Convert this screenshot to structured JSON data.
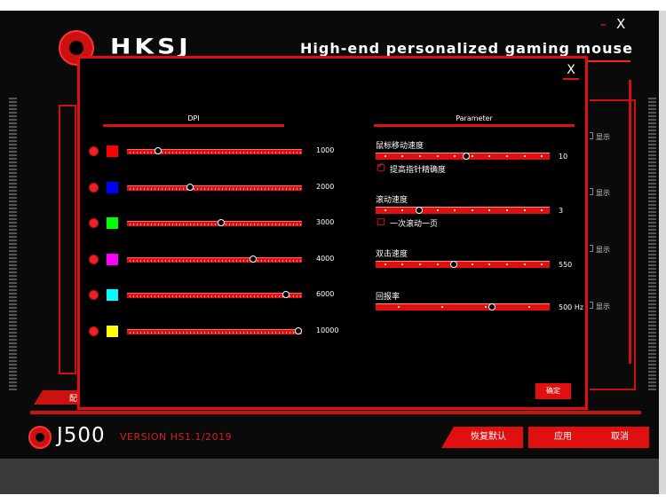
{
  "app": {
    "brand": "HKSJ",
    "tagline": "High-end personalized gaming mouse",
    "model": "J500",
    "version": "VERSION HS1.1/2019",
    "background_tab_char": "配",
    "background_show_label": "显示",
    "window_minimize": "–",
    "window_close": "X"
  },
  "footer": {
    "restore_label": "恢复默认",
    "apply_label": "应用",
    "cancel_label": "取消"
  },
  "modal": {
    "close_label": "X",
    "dpi_title": "DPI",
    "parameter_title": "Parameter",
    "ok_label": "确定",
    "dpi_levels": [
      {
        "color": "#ff0000",
        "value": "1000",
        "fraction": 0.18
      },
      {
        "color": "#0000ff",
        "value": "2000",
        "fraction": 0.36
      },
      {
        "color": "#00ff00",
        "value": "3000",
        "fraction": 0.54
      },
      {
        "color": "#ff00ff",
        "value": "4000",
        "fraction": 0.72
      },
      {
        "color": "#00ffff",
        "value": "6000",
        "fraction": 0.91
      },
      {
        "color": "#ffff00",
        "value": "10000",
        "fraction": 0.98
      }
    ],
    "params": [
      {
        "label": "鼠标移动速度",
        "value": "10",
        "fraction": 0.52,
        "dots": 10,
        "checkbox": {
          "label": "提高指针精确度",
          "checked": true
        }
      },
      {
        "label": "滚动速度",
        "value": "3",
        "fraction": 0.25,
        "dots": 10,
        "checkbox": {
          "label": "一次滚动一页",
          "checked": false
        }
      },
      {
        "label": "双击速度",
        "value": "550",
        "fraction": 0.45,
        "dots": 10
      },
      {
        "label": "回报率",
        "value": "500 Hz",
        "fraction": 0.67,
        "dots": 4
      }
    ]
  }
}
